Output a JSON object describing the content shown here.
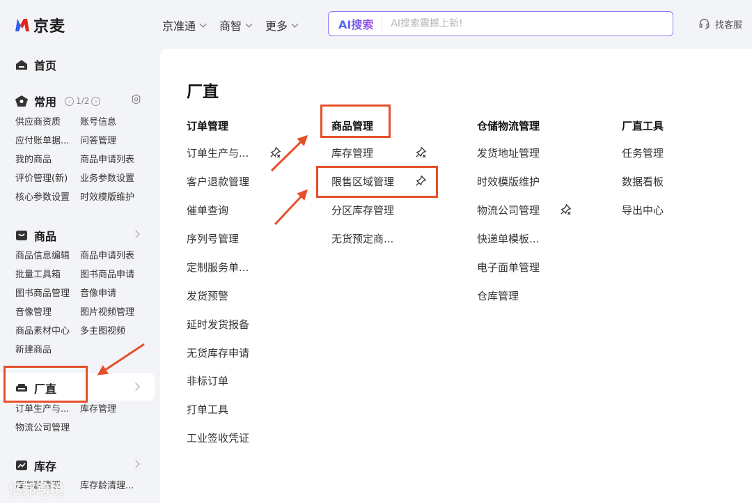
{
  "header": {
    "logo_text": "京麦",
    "nav": [
      {
        "label": "京准通"
      },
      {
        "label": "商智"
      },
      {
        "label": "更多"
      }
    ],
    "search": {
      "ai_label": "AI搜索",
      "placeholder": "AI搜索震撼上新!"
    },
    "service_label": "找客服"
  },
  "sidebar": {
    "home": "首页",
    "common": {
      "title": "常用",
      "page_indicator": "1/2",
      "links": [
        "供应商资质",
        "账号信息",
        "应付账单据...",
        "问答管理",
        "我的商品",
        "商品申请列表",
        "评价管理(新)",
        "业务参数设置",
        "核心参数设置",
        "时效模版维护"
      ]
    },
    "product": {
      "title": "商品",
      "links": [
        "商品信息编辑",
        "商品申请列表",
        "批量工具箱",
        "图书商品申请",
        "图书商品管理",
        "音像申请",
        "音像管理",
        "图片视频管理",
        "商品素材中心",
        "多主图视频",
        "新建商品"
      ]
    },
    "factory": {
      "title": "厂直",
      "links": [
        "订单生产与...",
        "库存管理",
        "物流公司管理"
      ]
    },
    "inventory": {
      "title": "库存",
      "links": [
        "库存龄清理",
        "库存龄清理..."
      ]
    }
  },
  "main": {
    "title": "厂直",
    "columns": [
      {
        "header": "订单管理",
        "items": [
          "订单生产与...",
          "客户退款管理",
          "催单查询",
          "序列号管理",
          "定制服务单...",
          "发货预警",
          "延时发货报备",
          "无货库存申请",
          "非标订单",
          "打单工具",
          "工业签收凭证"
        ]
      },
      {
        "header": "商品管理",
        "items": [
          "库存管理",
          "限售区域管理",
          "分区库存管理",
          "无货预定商..."
        ]
      },
      {
        "header": "仓储物流管理",
        "items": [
          "发货地址管理",
          "时效模版维护",
          "物流公司管理",
          "快递单模板...",
          "电子面单管理",
          "仓库管理"
        ]
      },
      {
        "header": "厂直工具",
        "items": [
          "任务管理",
          "数据看板",
          "导出中心"
        ]
      }
    ]
  },
  "watermark": "亿邦跨境",
  "colors": {
    "highlight": "#e4502a",
    "ai_gradient_start": "#4a6cf7",
    "ai_gradient_end": "#a34ee8",
    "logo_red": "#e1251b",
    "logo_blue": "#2f5cf5"
  }
}
